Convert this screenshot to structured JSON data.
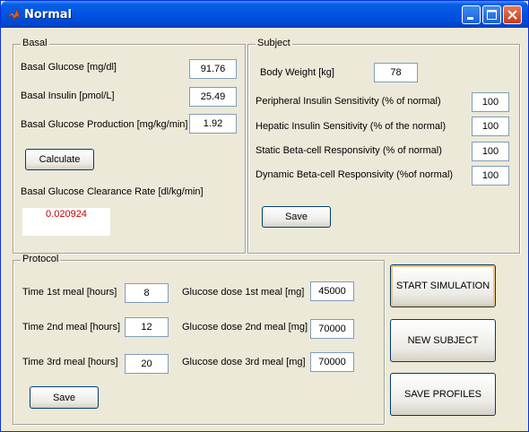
{
  "window": {
    "title": "Normal"
  },
  "basal": {
    "legend": "Basal",
    "glucose_label": "Basal Glucose [mg/dl]",
    "glucose_value": "91.76",
    "insulin_label": "Basal Insulin [pmol/L]",
    "insulin_value": "25.49",
    "production_label": "Basal Glucose Production [mg/kg/min]",
    "production_value": "1.92",
    "calculate_label": "Calculate",
    "clearance_label": "Basal Glucose Clearance Rate [dl/kg/min]",
    "clearance_value": "0.020924"
  },
  "subject": {
    "legend": "Subject",
    "body_weight_label": "Body Weight [kg]",
    "body_weight_value": "78",
    "peripheral_label": "Peripheral Insulin Sensitivity (% of normal)",
    "peripheral_value": "100",
    "hepatic_label": "Hepatic Insulin Sensitivity (% of the normal)",
    "hepatic_value": "100",
    "static_label": "Static Beta-cell Responsivity (% of normal)",
    "static_value": "100",
    "dynamic_label": "Dynamic Beta-cell Responsivity (%of normal)",
    "dynamic_value": "100",
    "save_label": "Save"
  },
  "protocol": {
    "legend": "Protocol",
    "time1_label": "Time 1st meal [hours]",
    "time1_value": "8",
    "time2_label": "Time 2nd meal [hours]",
    "time2_value": "12",
    "time3_label": "Time 3rd meal [hours]",
    "time3_value": "20",
    "dose1_label": "Glucose dose 1st meal [mg]",
    "dose1_value": "45000",
    "dose2_label": "Glucose dose 2nd meal [mg]",
    "dose2_value": "70000",
    "dose3_label": "Glucose dose 3rd meal [mg]",
    "dose3_value": "70000",
    "save_label": "Save"
  },
  "actions": {
    "start_label": "START SIMULATION",
    "new_subject_label": "NEW SUBJECT",
    "save_profiles_label": "SAVE PROFILES"
  },
  "icons": {
    "app": "matlab-icon",
    "minimize": "minimize-icon",
    "maximize": "maximize-icon",
    "close": "close-icon"
  },
  "colors": {
    "titlebar": "#0054e3",
    "result_text": "#c00000",
    "window_bg": "#ece9d8"
  }
}
